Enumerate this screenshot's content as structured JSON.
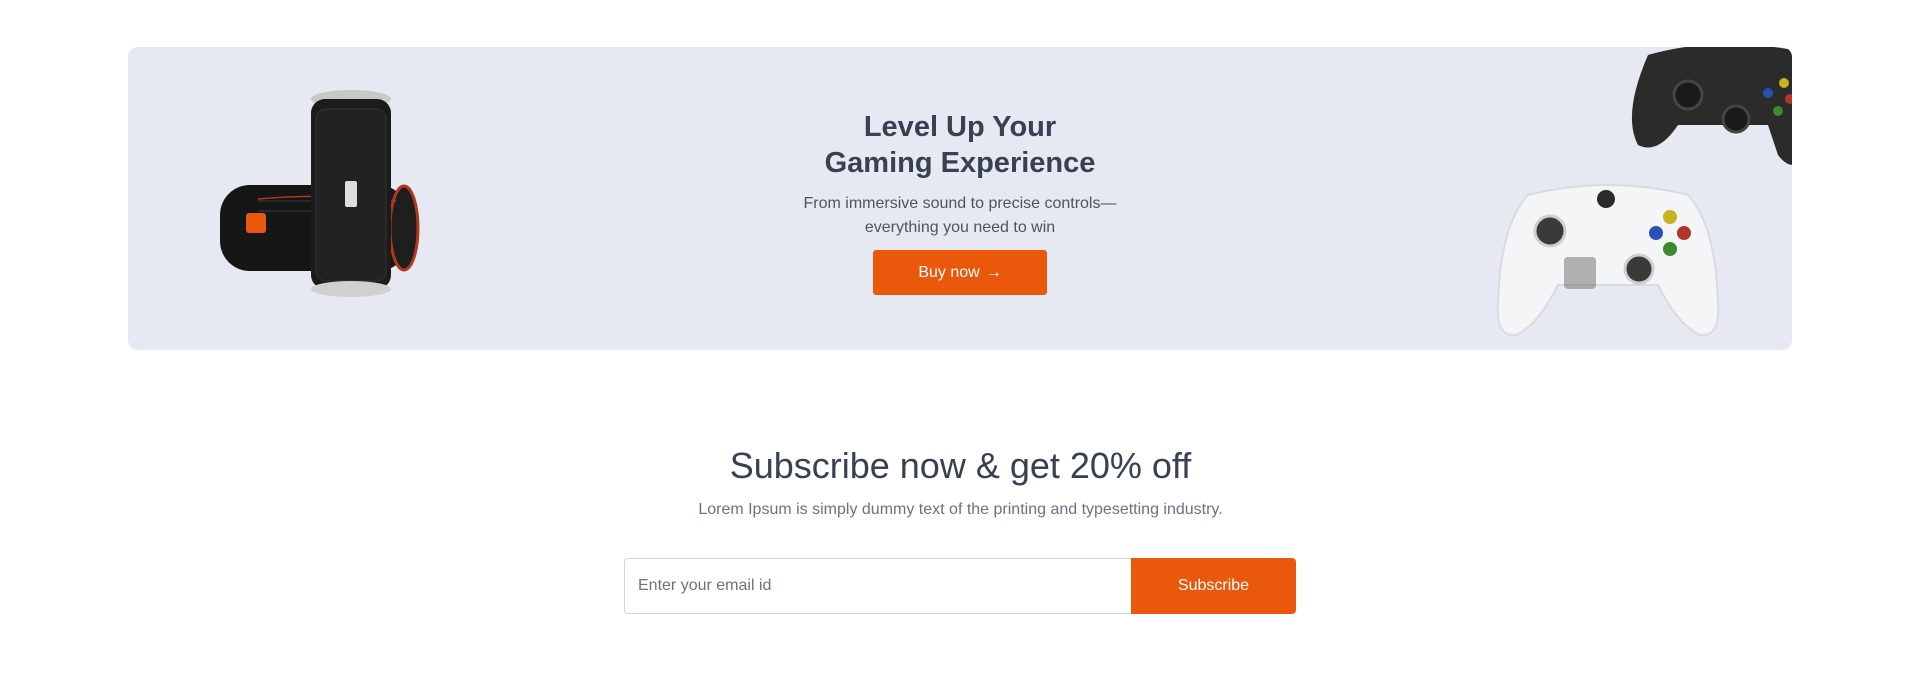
{
  "banner": {
    "title_line1": "Level Up Your",
    "title_line2": "Gaming Experience",
    "subtitle_line1": "From immersive sound to precise controls—",
    "subtitle_line2": "everything you need to win",
    "buy_label": "Buy now",
    "buy_arrow": "→",
    "accent_color": "#ea580c",
    "background_color": "#e6e9f2"
  },
  "images": {
    "speaker": "jbl-speaker-image",
    "controller_white": "xbox-controller-white-image",
    "controller_black": "xbox-controller-black-image"
  },
  "subscribe": {
    "title": "Subscribe now & get 20% off",
    "description": "Lorem Ipsum is simply dummy text of the printing and typesetting industry.",
    "email_placeholder": "Enter your email id",
    "email_value": "",
    "button_label": "Subscribe"
  }
}
